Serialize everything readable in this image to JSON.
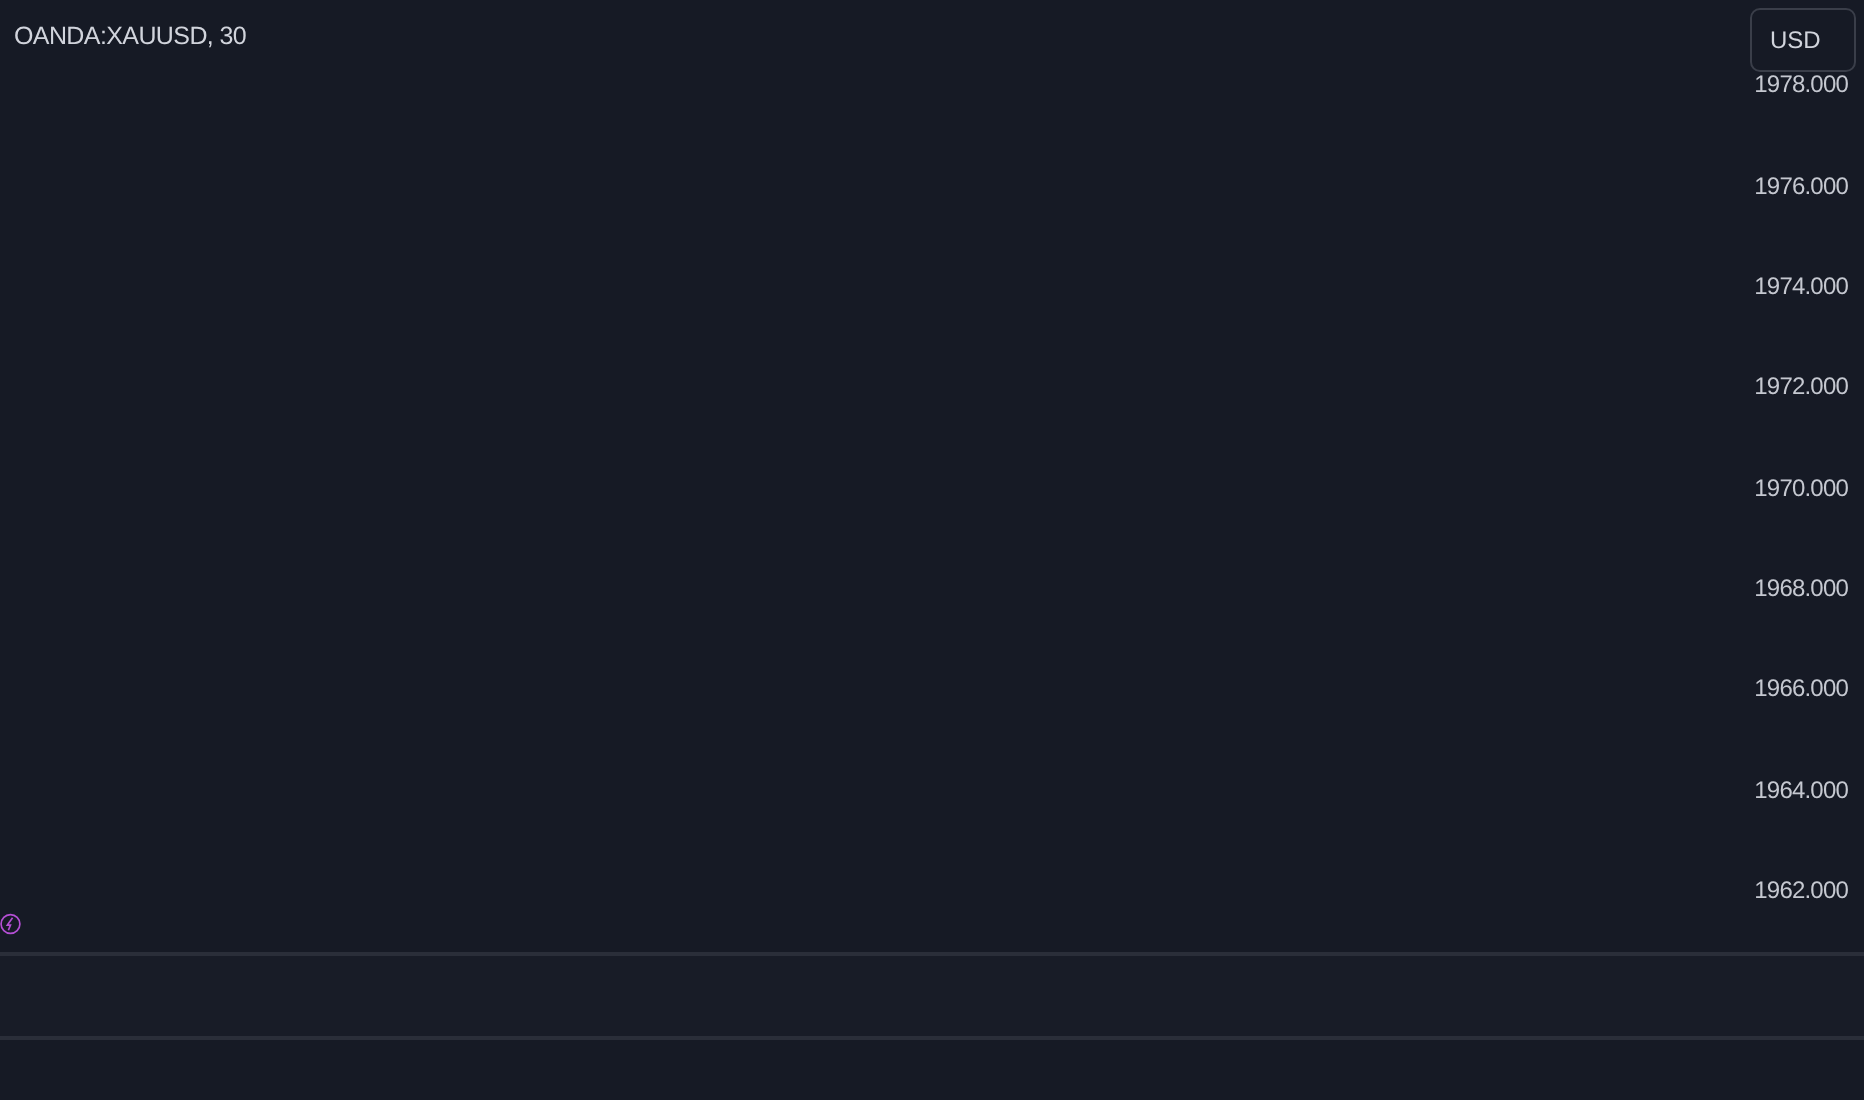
{
  "chart": {
    "symbol": "OANDA:XAUUSD, 30"
  },
  "currency_button": {
    "label": "USD"
  },
  "price_scale": [
    "1978.000",
    "1976.000",
    "1974.000",
    "1972.000",
    "1970.000",
    "1968.000",
    "1966.000",
    "1964.000",
    "1962.000"
  ]
}
